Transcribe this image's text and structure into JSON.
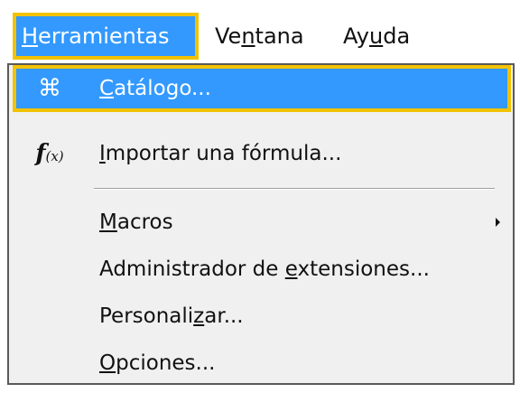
{
  "menubar": {
    "items": [
      {
        "label_underlined": "H",
        "label_rest": "erramientas"
      },
      {
        "label_pre": "Ve",
        "label_underlined": "n",
        "label_rest": "tana"
      },
      {
        "label_pre": "Ay",
        "label_underlined": "u",
        "label_rest": "da"
      }
    ]
  },
  "dropdown": {
    "highlight_color": "#3399ff",
    "focus_outline_color": "#f2c200",
    "items": [
      {
        "icon": "command-icon",
        "icon_glyph": "⌘",
        "label_underlined": "C",
        "label_rest": "atálogo..."
      },
      {
        "icon": "formula-icon",
        "icon_glyph": "f",
        "icon_glyph_suffix": "(x)",
        "label_underlined": "I",
        "label_rest": "mportar una fórmula..."
      },
      {
        "label_underlined": "M",
        "label_rest": "acros",
        "has_submenu": true
      },
      {
        "label_pre": "Administrador de ",
        "label_underlined": "e",
        "label_rest": "xtensiones..."
      },
      {
        "label_pre": "Personali",
        "label_underlined": "z",
        "label_rest": "ar..."
      },
      {
        "label_underlined": "O",
        "label_rest": "pciones..."
      }
    ]
  }
}
